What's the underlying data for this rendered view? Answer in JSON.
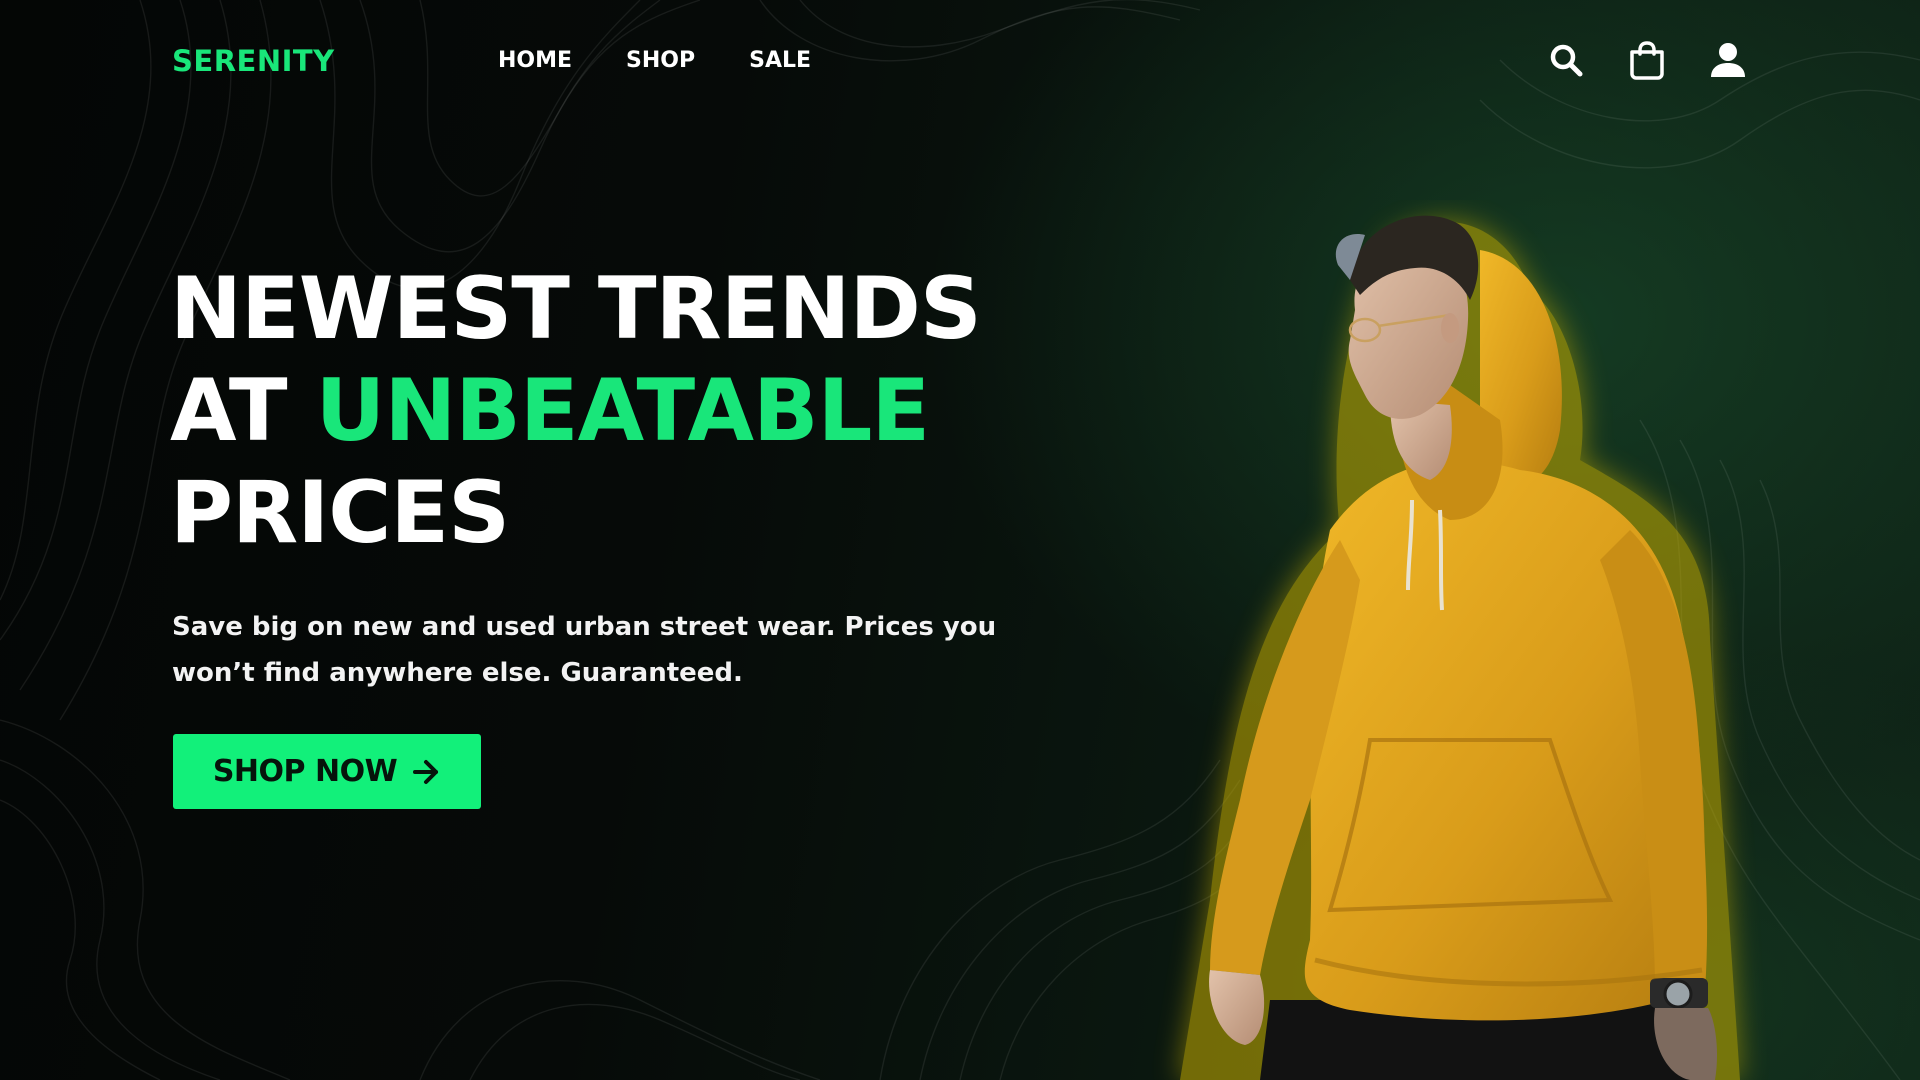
{
  "brand": {
    "logo_text": "SERENITY",
    "accent_color": "#19e67a",
    "background_color": "#050807"
  },
  "nav": {
    "links": [
      {
        "label": "HOME"
      },
      {
        "label": "SHOP"
      },
      {
        "label": "SALE"
      }
    ],
    "icons": [
      "search-icon",
      "shopping-bag-icon",
      "user-icon"
    ]
  },
  "hero": {
    "headline_line1": "NEWEST TRENDS",
    "headline_line2_prefix": "AT ",
    "headline_line2_accent": "UNBEATABLE",
    "headline_line3": "PRICES",
    "subtext": "Save big on new and used urban street wear. Prices you won’t find anywhere else. Guaranteed.",
    "cta_label": "SHOP NOW",
    "cta_icon": "arrow-right-icon",
    "cta_color": "#12f07a",
    "image": {
      "subject": "model-in-yellow-hoodie",
      "hoodie_color": "#e0a820"
    }
  }
}
